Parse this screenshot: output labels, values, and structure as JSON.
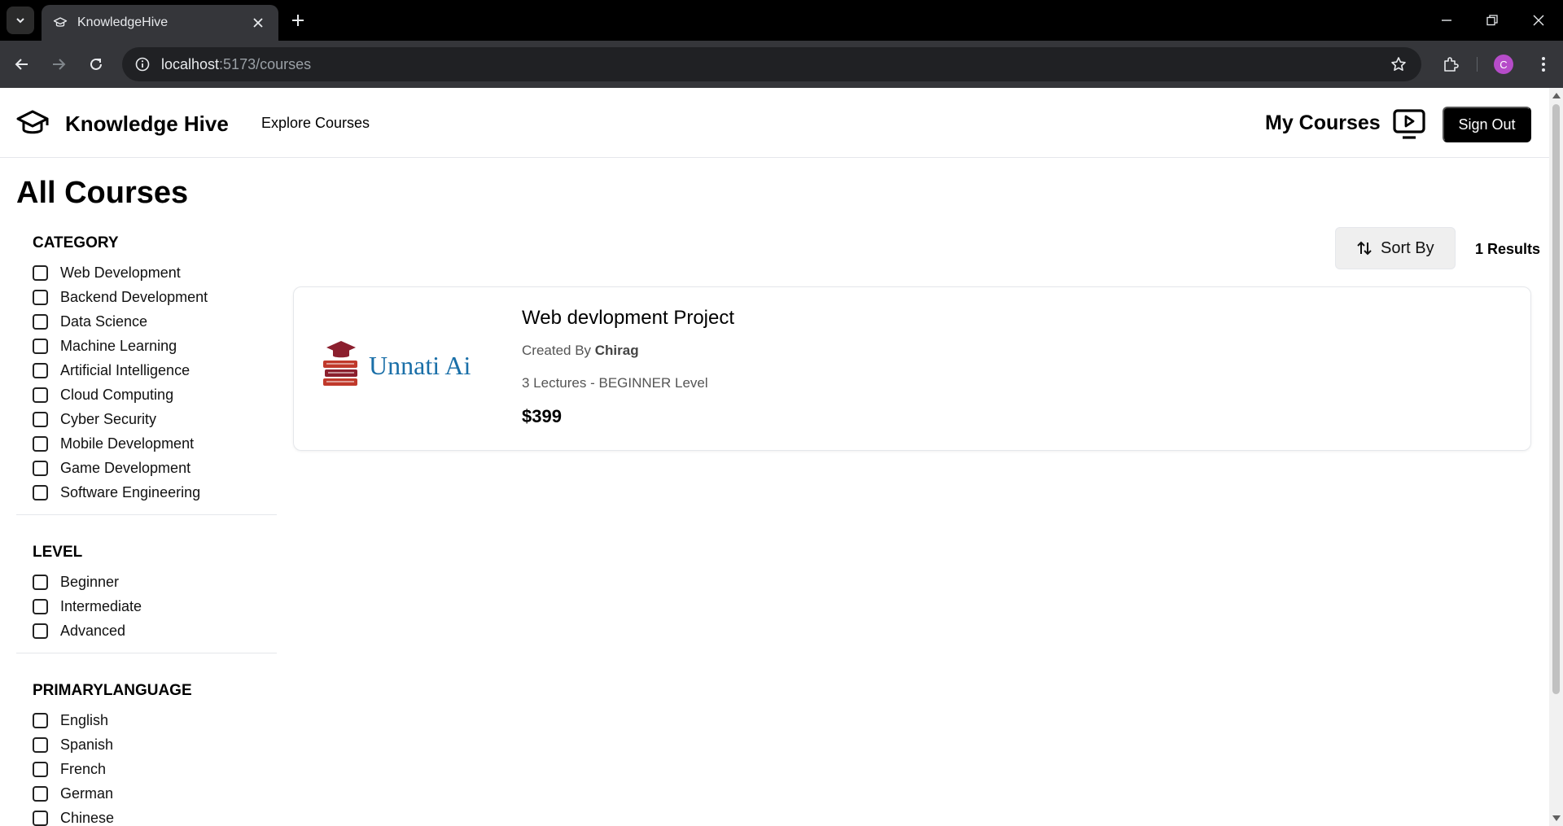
{
  "browser": {
    "tab_title": "KnowledgeHive",
    "url_host": "localhost",
    "url_path": ":5173/courses",
    "profile_initial": "C"
  },
  "header": {
    "brand": "Knowledge Hive",
    "nav_explore": "Explore Courses",
    "my_courses": "My Courses",
    "sign_out": "Sign Out"
  },
  "page_title": "All Courses",
  "filters": {
    "category": {
      "title": "CATEGORY",
      "items": [
        "Web Development",
        "Backend Development",
        "Data Science",
        "Machine Learning",
        "Artificial Intelligence",
        "Cloud Computing",
        "Cyber Security",
        "Mobile Development",
        "Game Development",
        "Software Engineering"
      ]
    },
    "level": {
      "title": "LEVEL",
      "items": [
        "Beginner",
        "Intermediate",
        "Advanced"
      ]
    },
    "language": {
      "title": "PRIMARYLANGUAGE",
      "items": [
        "English",
        "Spanish",
        "French",
        "German",
        "Chinese"
      ]
    }
  },
  "sort": {
    "label": "Sort By"
  },
  "results": "1 Results",
  "course": {
    "title": "Web devlopment Project",
    "created_by_prefix": "Created By ",
    "author": "Chirag",
    "meta": "3 Lectures - BEGINNER Level",
    "price": "$399",
    "image_text": "Unnati Ai"
  }
}
